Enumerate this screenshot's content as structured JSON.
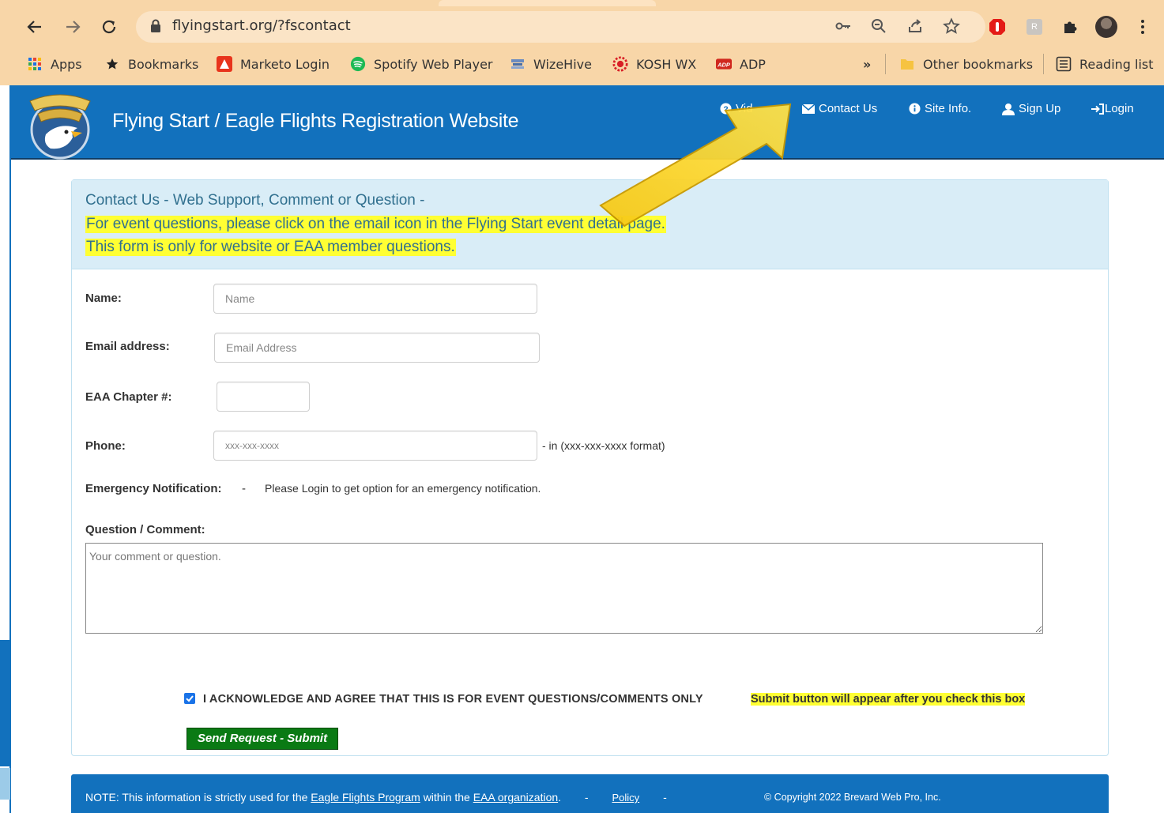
{
  "browser": {
    "url": "flyingstart.org/?fscontact",
    "bookmarks": [
      {
        "label": "Apps",
        "icon": "apps-grid-icon"
      },
      {
        "label": "Bookmarks",
        "icon": "star-icon"
      },
      {
        "label": "Marketo Login",
        "icon": "marketo-icon"
      },
      {
        "label": "Spotify Web Player",
        "icon": "spotify-icon"
      },
      {
        "label": "WizeHive",
        "icon": "wizehive-icon"
      },
      {
        "label": "KOSH WX",
        "icon": "kosh-icon"
      },
      {
        "label": "ADP",
        "icon": "adp-icon"
      }
    ],
    "overflow_label": "»",
    "other_bookmarks": "Other bookmarks",
    "reading_list": "Reading list"
  },
  "site": {
    "title": "Flying Start / Eagle Flights Registration Website",
    "nav": {
      "videos": "Vid",
      "contact": "Contact Us",
      "site_info": "Site Info.",
      "sign_up": "Sign Up",
      "login": "Login"
    }
  },
  "form": {
    "title": "Contact Us - Web Support, Comment or Question -",
    "notice_1": "For event questions, please click on the email icon in the Flying Start event detail page.",
    "notice_2": "This form is only for website or EAA member questions.",
    "name_label": "Name:",
    "name_placeholder": "Name",
    "email_label": "Email address:",
    "email_placeholder": "Email Address",
    "chapter_label": "EAA Chapter #:",
    "chapter_placeholder": "",
    "phone_label": "Phone:",
    "phone_placeholder": "xxx-xxx-xxxx",
    "phone_hint": "- in (xxx-xxx-xxxx format)",
    "emergency_label": "Emergency Notification:",
    "emergency_dash": "-",
    "emergency_text": "Please Login to get option for an emergency notification.",
    "comment_label": "Question / Comment:",
    "comment_placeholder": "Your comment or question.",
    "ack_text": "I ACKNOWLEDGE AND AGREE THAT THIS IS FOR EVENT QUESTIONS/COMMENTS ONLY",
    "ack_note": "Submit button will appear after you check this box",
    "ack_checked": true,
    "submit_label": "Send Request - Submit"
  },
  "footer": {
    "prefix": "NOTE: This information is strictly used for the",
    "link_program": "Eagle Flights Program",
    "mid": "within the",
    "link_org": "EAA organization",
    "period": ".",
    "sep1": "-",
    "policy": "Policy",
    "sep2": "-",
    "copyright": "© Copyright 2022 Brevard Web Pro, Inc."
  },
  "colors": {
    "chrome": "#f8d6a8",
    "header_blue": "#1271bd",
    "highlight": "#ffff33",
    "submit_green": "#0a7a14",
    "arrow": "#f4c20d"
  }
}
